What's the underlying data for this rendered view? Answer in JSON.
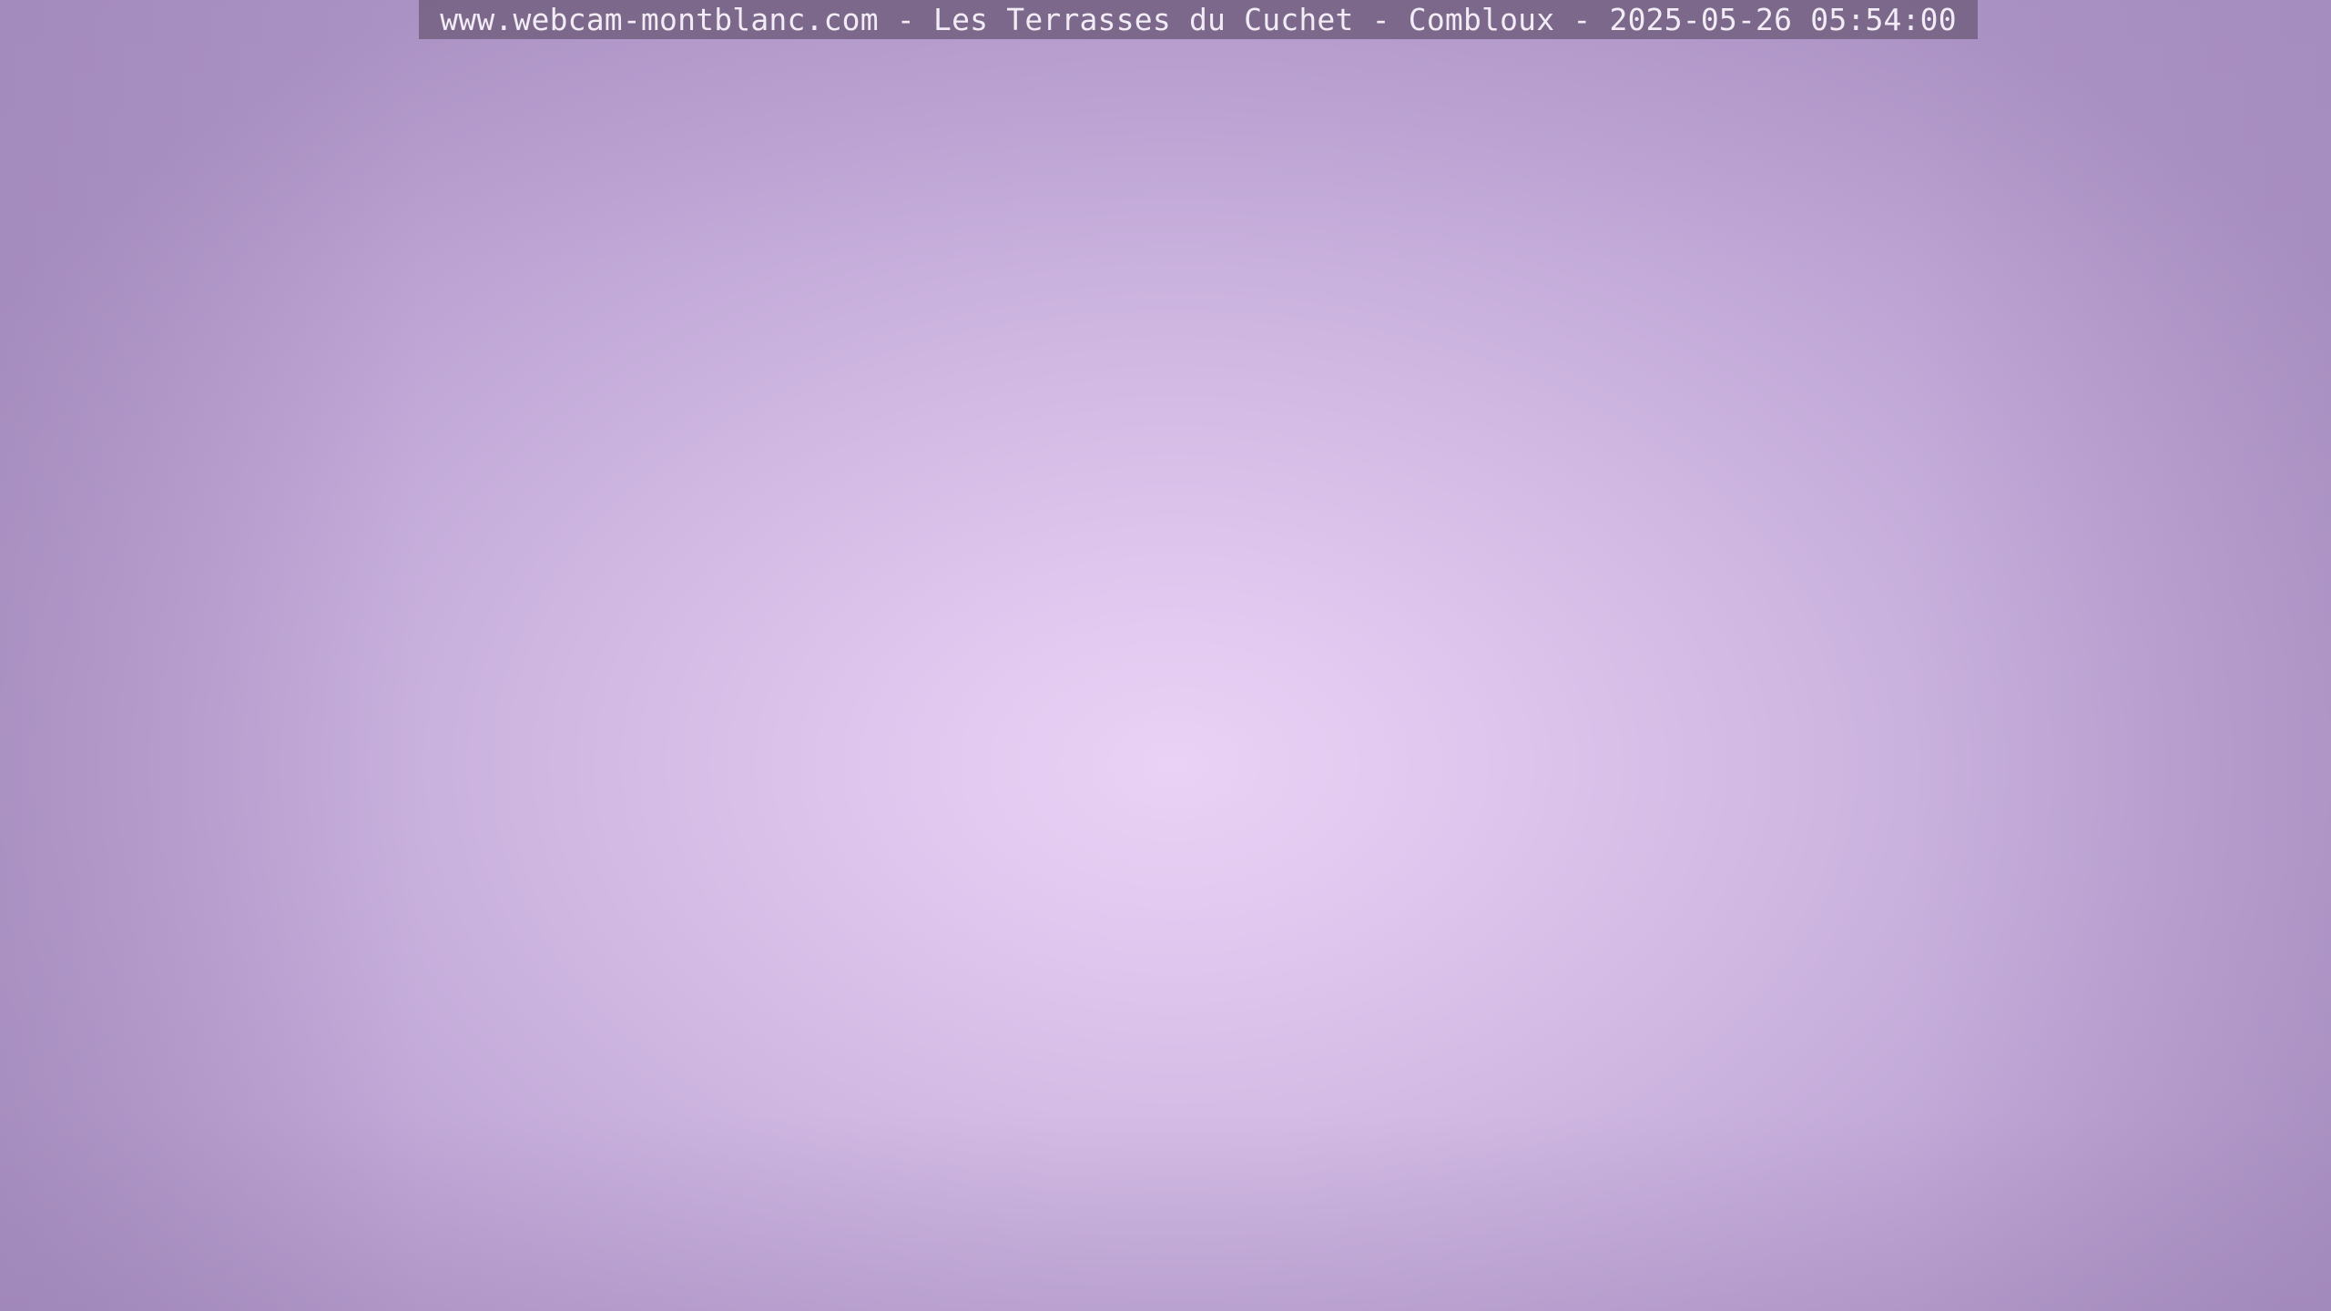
{
  "overlay": {
    "caption": "www.webcam-montblanc.com - Les Terrasses du Cuchet - Combloux - 2025-05-26 05:54:00"
  },
  "colors": {
    "sky_center": "#e9d2f5",
    "sky_edge": "#ad94c6",
    "overlay_background": "#766484",
    "overlay_text": "#f2ecf6"
  }
}
